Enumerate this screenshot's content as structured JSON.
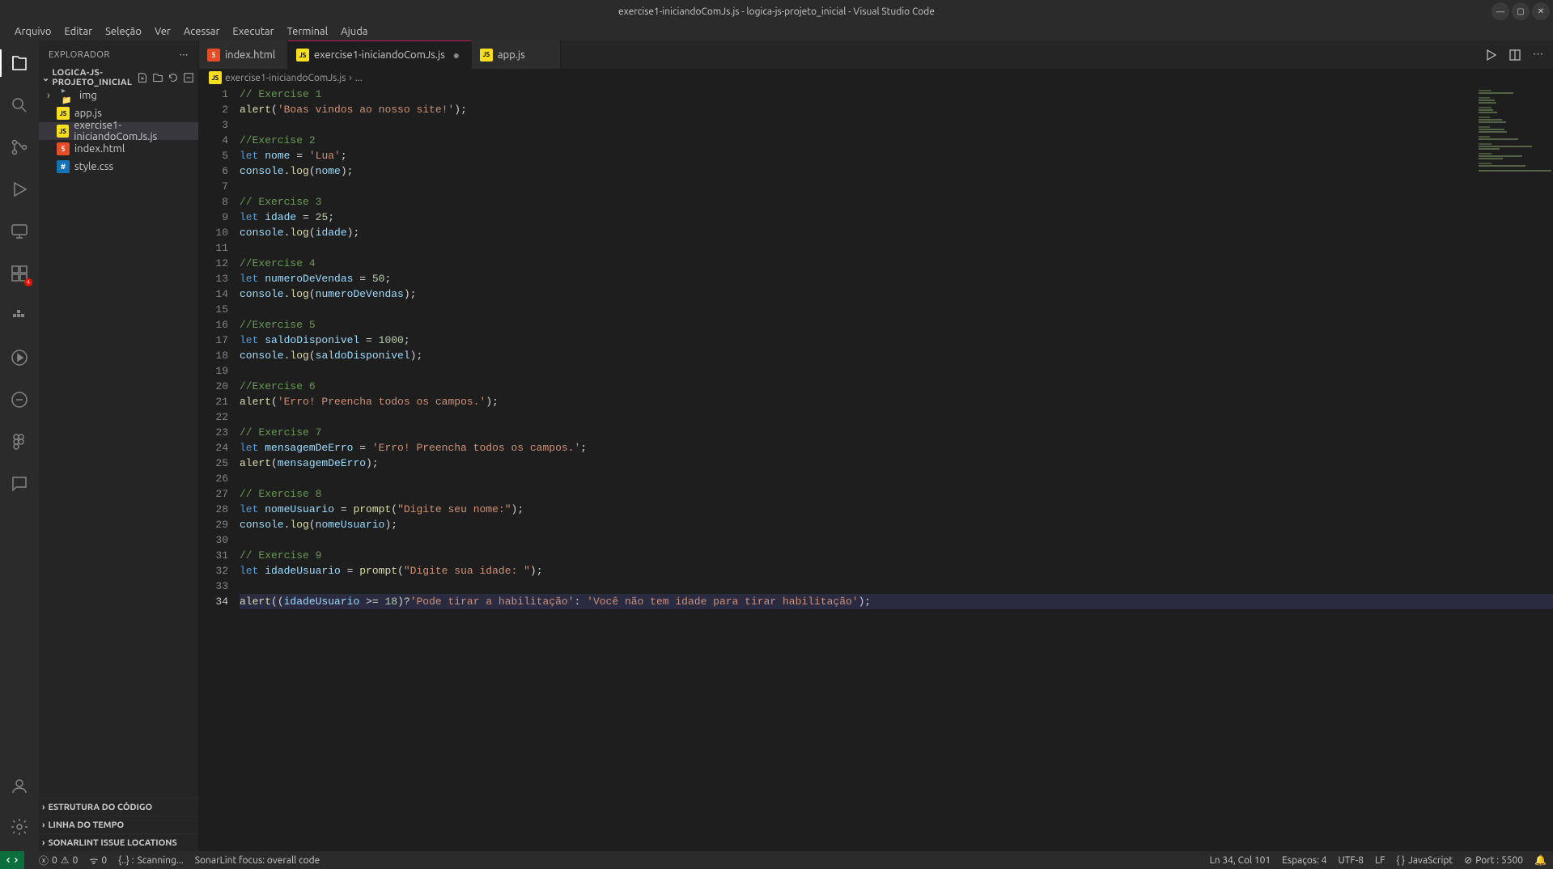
{
  "title": "exercise1-iniciandoComJs.js - logica-js-projeto_inicial - Visual Studio Code",
  "menu": [
    "Arquivo",
    "Editar",
    "Seleção",
    "Ver",
    "Acessar",
    "Executar",
    "Terminal",
    "Ajuda"
  ],
  "sidebar": {
    "header": "EXPLORADOR",
    "project": "LOGICA-JS-PROJETO_INICIAL",
    "items": [
      {
        "name": "img",
        "type": "folder"
      },
      {
        "name": "app.js",
        "type": "js"
      },
      {
        "name": "exercise1-iniciandoComJs.js",
        "type": "js",
        "selected": true
      },
      {
        "name": "index.html",
        "type": "html"
      },
      {
        "name": "style.css",
        "type": "css"
      }
    ],
    "sections": [
      "ESTRUTURA DO CÓDIGO",
      "LINHA DO TEMPO",
      "SONARLINT ISSUE LOCATIONS"
    ]
  },
  "tabs": [
    {
      "label": "index.html",
      "icon": "html",
      "active": false,
      "dirty": false
    },
    {
      "label": "exercise1-iniciandoComJs.js",
      "icon": "js",
      "active": true,
      "dirty": true
    },
    {
      "label": "app.js",
      "icon": "js",
      "active": false,
      "dirty": false
    }
  ],
  "breadcrumb": {
    "file": "exercise1-iniciandoComJs.js",
    "sep": "›",
    "rest": "..."
  },
  "code": {
    "lines": [
      [
        [
          "comment",
          "// Exercise 1"
        ]
      ],
      [
        [
          "fn",
          "alert"
        ],
        [
          "punc",
          "("
        ],
        [
          "str",
          "'Boas vindos ao nosso site!'"
        ],
        [
          "punc",
          ");"
        ]
      ],
      [],
      [
        [
          "comment",
          "//Exercise 2"
        ]
      ],
      [
        [
          "keyword",
          "let "
        ],
        [
          "var",
          "nome"
        ],
        [
          "punc",
          " = "
        ],
        [
          "str",
          "'Lua'"
        ],
        [
          "punc",
          ";"
        ]
      ],
      [
        [
          "obj",
          "console"
        ],
        [
          "punc",
          "."
        ],
        [
          "fn",
          "log"
        ],
        [
          "punc",
          "("
        ],
        [
          "var",
          "nome"
        ],
        [
          "punc",
          ");"
        ]
      ],
      [],
      [
        [
          "comment",
          "// Exercise 3"
        ]
      ],
      [
        [
          "keyword",
          "let "
        ],
        [
          "var",
          "idade"
        ],
        [
          "punc",
          " = "
        ],
        [
          "num",
          "25"
        ],
        [
          "punc",
          ";"
        ]
      ],
      [
        [
          "obj",
          "console"
        ],
        [
          "punc",
          "."
        ],
        [
          "fn",
          "log"
        ],
        [
          "punc",
          "("
        ],
        [
          "var",
          "idade"
        ],
        [
          "punc",
          ");"
        ]
      ],
      [],
      [
        [
          "comment",
          "//Exercise 4"
        ]
      ],
      [
        [
          "keyword",
          "let "
        ],
        [
          "var",
          "numeroDeVendas"
        ],
        [
          "punc",
          " = "
        ],
        [
          "num",
          "50"
        ],
        [
          "punc",
          ";"
        ]
      ],
      [
        [
          "obj",
          "console"
        ],
        [
          "punc",
          "."
        ],
        [
          "fn",
          "log"
        ],
        [
          "punc",
          "("
        ],
        [
          "var",
          "numeroDeVendas"
        ],
        [
          "punc",
          ");"
        ]
      ],
      [],
      [
        [
          "comment",
          "//Exercise 5"
        ]
      ],
      [
        [
          "keyword",
          "let "
        ],
        [
          "var",
          "saldoDisponivel"
        ],
        [
          "punc",
          " = "
        ],
        [
          "num",
          "1000"
        ],
        [
          "punc",
          ";"
        ]
      ],
      [
        [
          "obj",
          "console"
        ],
        [
          "punc",
          "."
        ],
        [
          "fn",
          "log"
        ],
        [
          "punc",
          "("
        ],
        [
          "var",
          "saldoDisponivel"
        ],
        [
          "punc",
          ");"
        ]
      ],
      [],
      [
        [
          "comment",
          "//Exercise 6"
        ]
      ],
      [
        [
          "fn",
          "alert"
        ],
        [
          "punc",
          "("
        ],
        [
          "str",
          "'Erro! Preencha todos os campos.'"
        ],
        [
          "punc",
          ");"
        ]
      ],
      [],
      [
        [
          "comment",
          "// Exercise 7"
        ]
      ],
      [
        [
          "keyword",
          "let "
        ],
        [
          "var",
          "mensagemDeErro"
        ],
        [
          "punc",
          " = "
        ],
        [
          "str",
          "'Erro! Preencha todos os campos.'"
        ],
        [
          "punc",
          ";"
        ]
      ],
      [
        [
          "fn",
          "alert"
        ],
        [
          "punc",
          "("
        ],
        [
          "var",
          "mensagemDeErro"
        ],
        [
          "punc",
          ");"
        ]
      ],
      [],
      [
        [
          "comment",
          "// Exercise 8"
        ]
      ],
      [
        [
          "keyword",
          "let "
        ],
        [
          "var",
          "nomeUsuario"
        ],
        [
          "punc",
          " = "
        ],
        [
          "fn",
          "prompt"
        ],
        [
          "punc",
          "("
        ],
        [
          "str",
          "\"Digite seu nome:\""
        ],
        [
          "punc",
          ");"
        ]
      ],
      [
        [
          "obj",
          "console"
        ],
        [
          "punc",
          "."
        ],
        [
          "fn",
          "log"
        ],
        [
          "punc",
          "("
        ],
        [
          "var",
          "nomeUsuario"
        ],
        [
          "punc",
          ");"
        ]
      ],
      [],
      [
        [
          "comment",
          "// Exercise 9"
        ]
      ],
      [
        [
          "keyword",
          "let "
        ],
        [
          "var",
          "idadeUsuario"
        ],
        [
          "punc",
          " = "
        ],
        [
          "fn",
          "prompt"
        ],
        [
          "punc",
          "("
        ],
        [
          "str",
          "\"Digite sua idade: \""
        ],
        [
          "punc",
          ");"
        ]
      ],
      [],
      [
        [
          "fn",
          "alert"
        ],
        [
          "punc",
          "(("
        ],
        [
          "var",
          "idadeUsuario"
        ],
        [
          "punc",
          " >= "
        ],
        [
          "num",
          "18"
        ],
        [
          "punc",
          ")?"
        ],
        [
          "str",
          "'Pode tirar a habilitação'"
        ],
        [
          "punc",
          ": "
        ],
        [
          "str",
          "'Você não tem idade para tirar habilitação'"
        ],
        [
          "punc",
          ");"
        ]
      ]
    ],
    "currentLine": 34
  },
  "status": {
    "errors": "0",
    "warnings": "0",
    "ports": "0",
    "scanning_prefix": "{..} :",
    "scanning": "Scanning...",
    "sonar": "SonarLint focus: overall code",
    "ln_col": "Ln 34, Col 101",
    "spaces": "Espaços: 4",
    "encoding": "UTF-8",
    "eol": "LF",
    "lang_prefix": "{ }",
    "lang": "JavaScript",
    "port_prefix": "⊘",
    "port": "Port : 5500",
    "bell": "🔔"
  }
}
